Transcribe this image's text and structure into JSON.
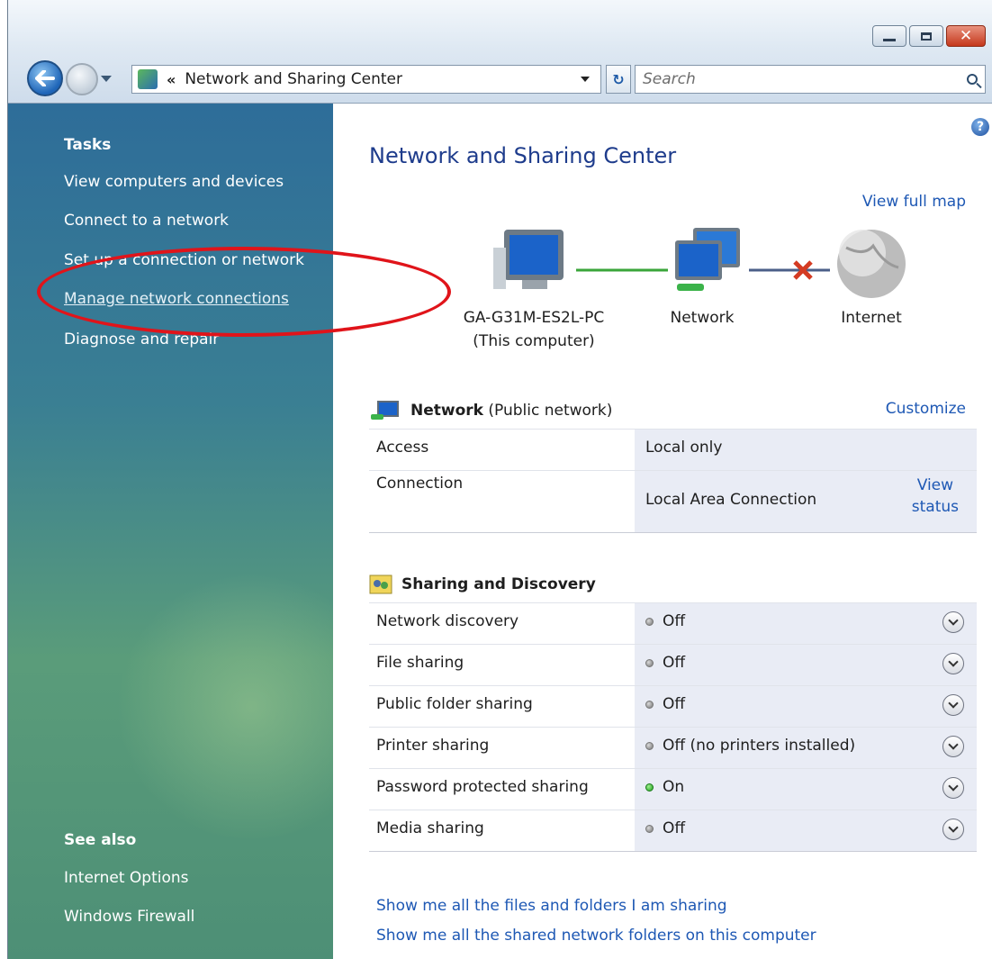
{
  "window": {
    "minimize_icon": "minimize-icon",
    "maximize_icon": "maximize-icon",
    "close_icon": "close-icon"
  },
  "addressbar": {
    "path_prefix": "«",
    "path": "Network and Sharing Center",
    "search_placeholder": "Search"
  },
  "sidebar": {
    "tasks_heading": "Tasks",
    "tasks": [
      "View computers and devices",
      "Connect to a network",
      "Set up a connection or network",
      "Manage network connections",
      "Diagnose and repair"
    ],
    "see_also_heading": "See also",
    "see_also": [
      "Internet Options",
      "Windows Firewall"
    ]
  },
  "main": {
    "title": "Network and Sharing Center",
    "view_full_map": "View full map",
    "map": {
      "computer_name": "GA-G31M-ES2L-PC",
      "computer_sub": "(This computer)",
      "network_label": "Network",
      "internet_label": "Internet"
    },
    "network": {
      "name": "Network",
      "type": "(Public network)",
      "customize": "Customize",
      "rows": [
        {
          "label": "Access",
          "value": "Local only"
        },
        {
          "label": "Connection",
          "value": "Local Area Connection",
          "action_line1": "View",
          "action_line2": "status"
        }
      ]
    },
    "sharing": {
      "heading": "Sharing and Discovery",
      "rows": [
        {
          "label": "Network discovery",
          "value": "Off",
          "on": false
        },
        {
          "label": "File sharing",
          "value": "Off",
          "on": false
        },
        {
          "label": "Public folder sharing",
          "value": "Off",
          "on": false
        },
        {
          "label": "Printer sharing",
          "value": "Off (no printers installed)",
          "on": false
        },
        {
          "label": "Password protected sharing",
          "value": "On",
          "on": true
        },
        {
          "label": "Media sharing",
          "value": "Off",
          "on": false
        }
      ]
    },
    "bottom_links": [
      "Show me all the files and folders I am sharing",
      "Show me all the shared network folders on this computer"
    ]
  },
  "colors": {
    "link": "#1e58b4",
    "title": "#1e3c8c",
    "highlight_oval": "#e0141a",
    "status_on": "#1c9d1c"
  }
}
